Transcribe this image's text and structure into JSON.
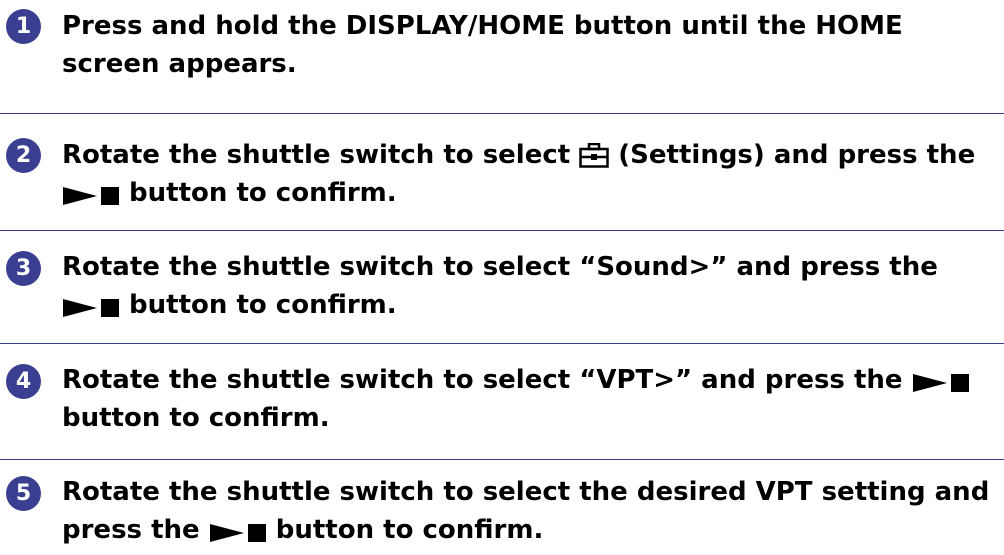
{
  "steps": [
    {
      "number": "1",
      "text_a": "Press and hold the DISPLAY/HOME button until the HOME screen appears."
    },
    {
      "number": "2",
      "text_a": "Rotate the shuttle switch to select ",
      "text_b": " (Settings) and press the ",
      "text_c": " button to confirm."
    },
    {
      "number": "3",
      "text_a": "Rotate the shuttle switch to select “Sound>” and press the ",
      "text_b": " button to confirm."
    },
    {
      "number": "4",
      "text_a": "Rotate the shuttle switch to select “VPT>” and press the ",
      "text_b": " button to confirm."
    },
    {
      "number": "5",
      "text_a": "Rotate the shuttle switch to select the desired VPT setting and press the ",
      "text_b": " button to confirm."
    }
  ],
  "icons": {
    "settings": "settings-icon",
    "play_stop": "play-stop-icon"
  },
  "colors": {
    "accent": "#3b3f91",
    "text": "#000000",
    "background": "#ffffff"
  }
}
